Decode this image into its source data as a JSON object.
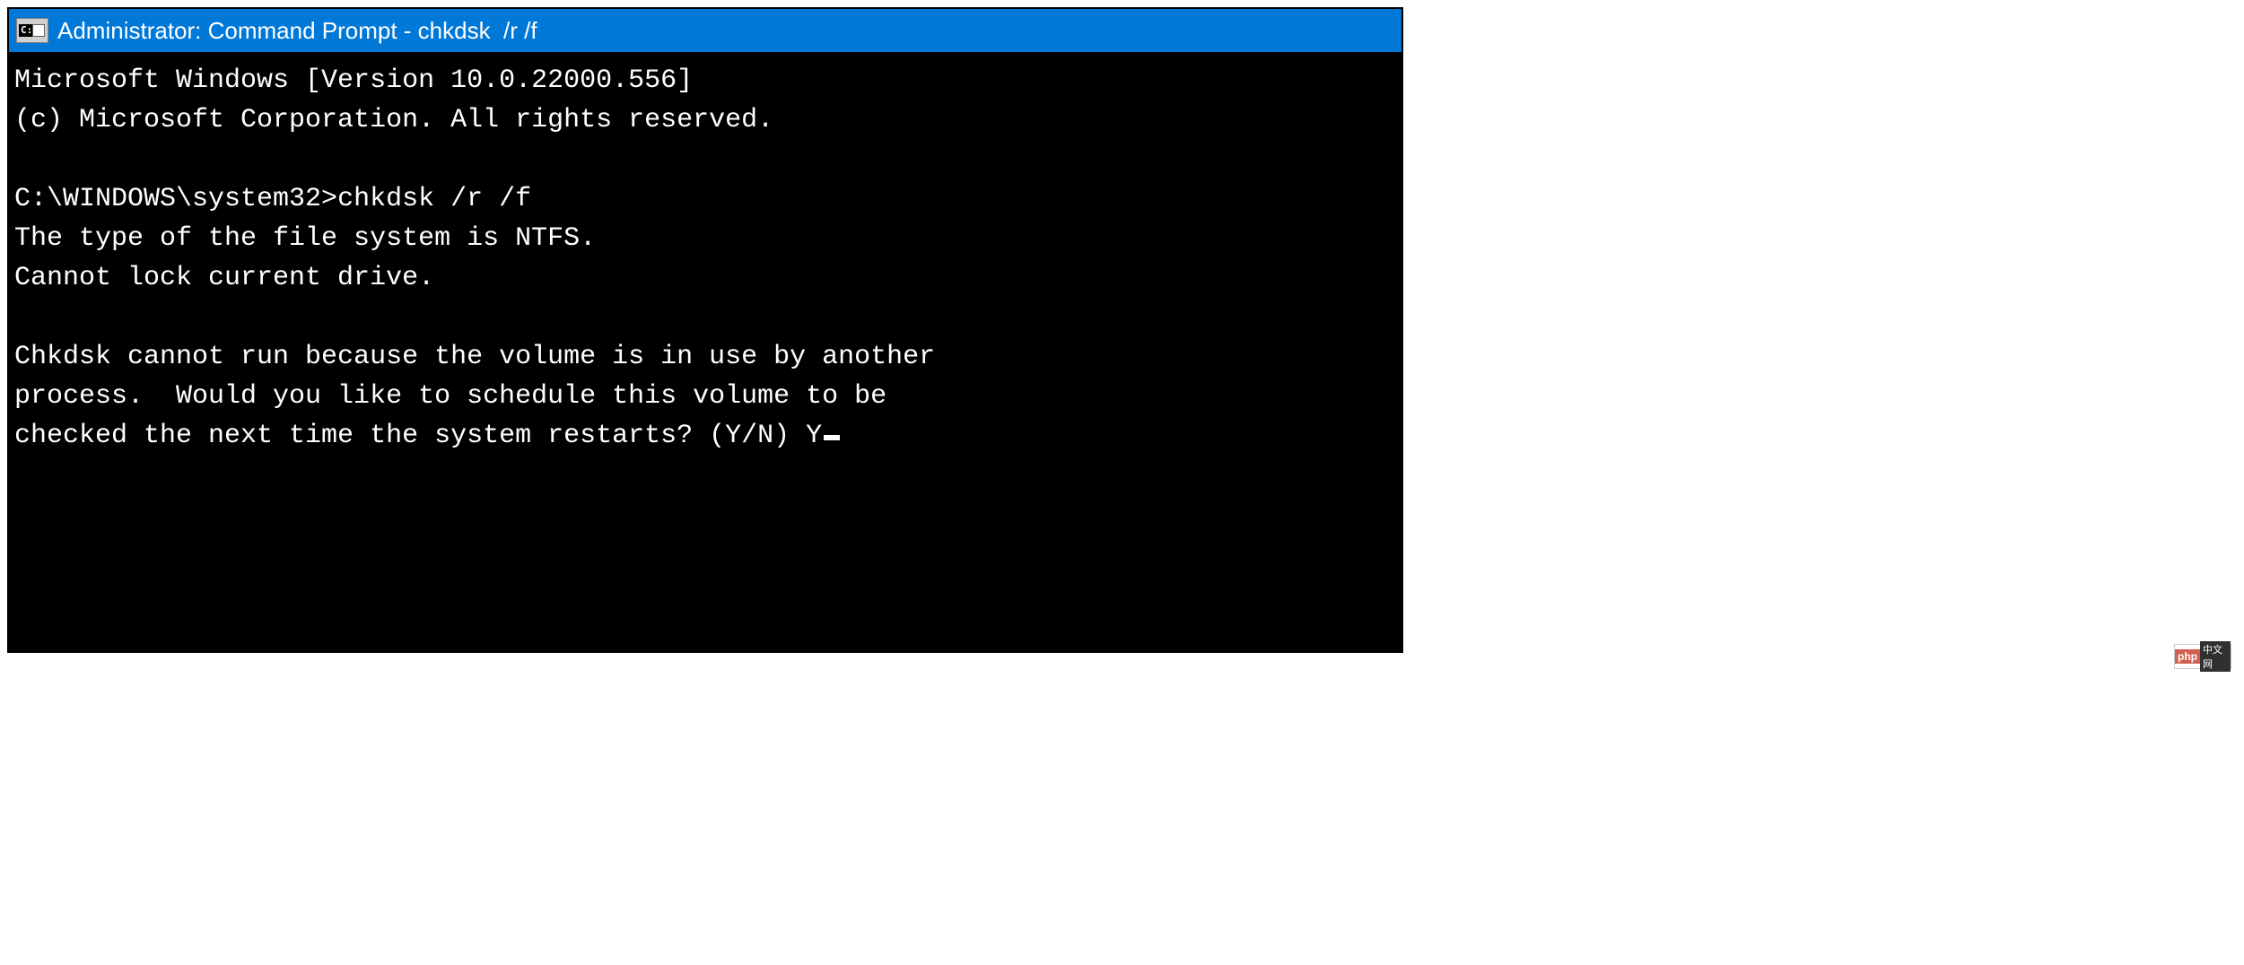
{
  "window": {
    "title": "Administrator: Command Prompt - chkdsk  /r /f",
    "icon_label": "C:\\"
  },
  "terminal": {
    "lines": [
      "Microsoft Windows [Version 10.0.22000.556]",
      "(c) Microsoft Corporation. All rights reserved.",
      "",
      "C:\\WINDOWS\\system32>chkdsk /r /f",
      "The type of the file system is NTFS.",
      "Cannot lock current drive.",
      "",
      "Chkdsk cannot run because the volume is in use by another",
      "process.  Would you like to schedule this volume to be",
      "checked the next time the system restarts? (Y/N) Y"
    ],
    "prompt": "C:\\WINDOWS\\system32>",
    "command": "chkdsk /r /f",
    "user_input": "Y"
  },
  "watermark": {
    "left": "php",
    "right": "中文网"
  }
}
